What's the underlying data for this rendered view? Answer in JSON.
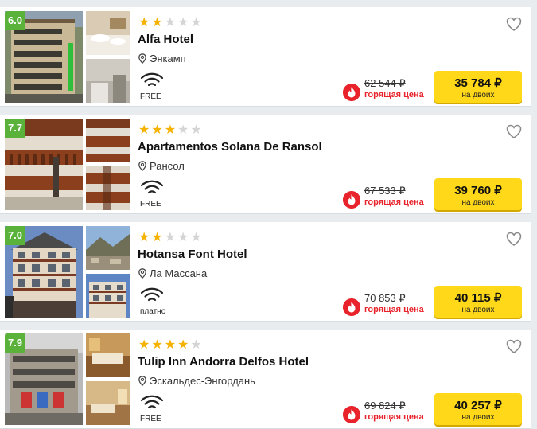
{
  "hotels": [
    {
      "rating": "6.0",
      "rating_color": "#5ab23b",
      "stars": 2,
      "name": "Alfa Hotel",
      "location": "Энкамп",
      "amenity": "FREE",
      "old_price": "62 544 ₽",
      "hot_label": "горящая цена",
      "price": "35 784 ₽",
      "price_sub": "на двоих"
    },
    {
      "rating": "7.7",
      "rating_color": "#5ab23b",
      "stars": 3,
      "name": "Apartamentos Solana De Ransol",
      "location": "Рансол",
      "amenity": "FREE",
      "old_price": "67 533 ₽",
      "hot_label": "горящая цена",
      "price": "39 760 ₽",
      "price_sub": "на двоих"
    },
    {
      "rating": "7.0",
      "rating_color": "#5ab23b",
      "stars": 2,
      "name": "Hotansa Font Hotel",
      "location": "Ла Массана",
      "amenity": "платно",
      "old_price": "70 853 ₽",
      "hot_label": "горящая цена",
      "price": "40 115 ₽",
      "price_sub": "на двоих"
    },
    {
      "rating": "7.9",
      "rating_color": "#5ab23b",
      "stars": 4,
      "name": "Tulip Inn Andorra Delfos Hotel",
      "location": "Эскальдес-Энгордань",
      "amenity": "FREE",
      "old_price": "69 824 ₽",
      "hot_label": "горящая цена",
      "price": "40 257 ₽",
      "price_sub": "на двоих"
    }
  ],
  "icons": {
    "star": "star-icon",
    "location": "location-pin-icon",
    "wifi": "wifi-icon",
    "favorite": "heart-icon",
    "hot": "fire-icon"
  },
  "colors": {
    "star_active": "#f6b200",
    "star_inactive": "#d5d5d5",
    "price_button": "#ffd81a",
    "hot_red": "#e8232b"
  }
}
